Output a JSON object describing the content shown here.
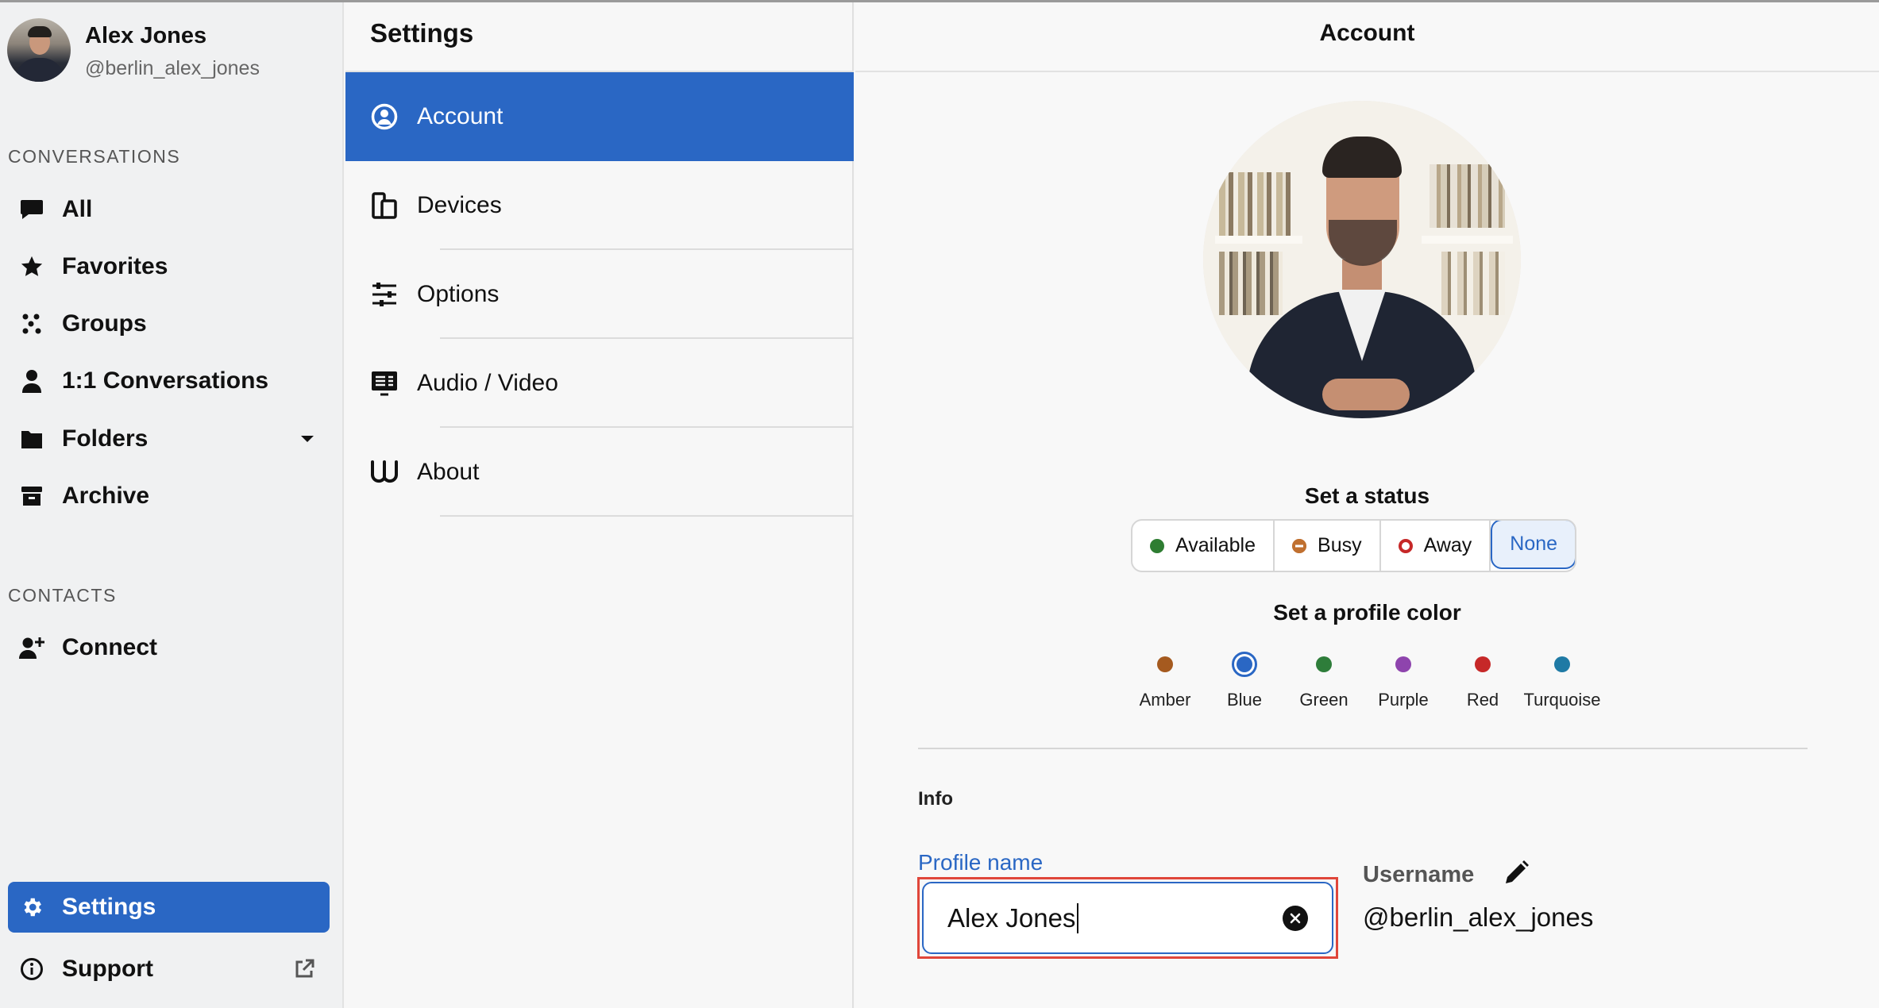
{
  "sidebar": {
    "user": {
      "name": "Alex Jones",
      "handle": "@berlin_alex_jones"
    },
    "conversations_label": "CONVERSATIONS",
    "conversations": [
      {
        "label": "All",
        "icon": "chat-bubble-icon"
      },
      {
        "label": "Favorites",
        "icon": "star-icon"
      },
      {
        "label": "Groups",
        "icon": "groups-icon"
      },
      {
        "label": "1:1 Conversations",
        "icon": "person-icon"
      },
      {
        "label": "Folders",
        "icon": "folder-icon"
      },
      {
        "label": "Archive",
        "icon": "archive-icon"
      }
    ],
    "contacts_label": "CONTACTS",
    "contacts": [
      {
        "label": "Connect",
        "icon": "add-person-icon"
      }
    ],
    "bottom": [
      {
        "label": "Settings",
        "icon": "gear-icon",
        "active": true
      },
      {
        "label": "Support",
        "icon": "info-icon"
      }
    ]
  },
  "settings": {
    "title": "Settings",
    "items": [
      {
        "label": "Account",
        "icon": "account-icon",
        "active": true
      },
      {
        "label": "Devices",
        "icon": "devices-icon"
      },
      {
        "label": "Options",
        "icon": "sliders-icon"
      },
      {
        "label": "Audio / Video",
        "icon": "audio-video-icon"
      },
      {
        "label": "About",
        "icon": "wire-logo-icon"
      }
    ]
  },
  "account": {
    "title": "Account",
    "status_title": "Set a status",
    "statuses": [
      {
        "label": "Available",
        "color": "#2e7d32"
      },
      {
        "label": "Busy",
        "color": "#c07030"
      },
      {
        "label": "Away",
        "color": "#c62828"
      },
      {
        "label": "None",
        "selected": true
      }
    ],
    "color_title": "Set a profile color",
    "colors": [
      {
        "label": "Amber",
        "hex": "#a55a1f"
      },
      {
        "label": "Blue",
        "hex": "#2a67c4",
        "selected": true
      },
      {
        "label": "Green",
        "hex": "#2e7d3a"
      },
      {
        "label": "Purple",
        "hex": "#8e44ad"
      },
      {
        "label": "Red",
        "hex": "#c62828"
      },
      {
        "label": "Turquoise",
        "hex": "#1f7aa5"
      }
    ],
    "info_label": "Info",
    "profile_name_label": "Profile name",
    "profile_name_value": "Alex Jones",
    "username_label": "Username",
    "username_value": "@berlin_alex_jones"
  },
  "colors": {
    "accent": "#2a67c4",
    "focus_outline": "#e0463a"
  }
}
